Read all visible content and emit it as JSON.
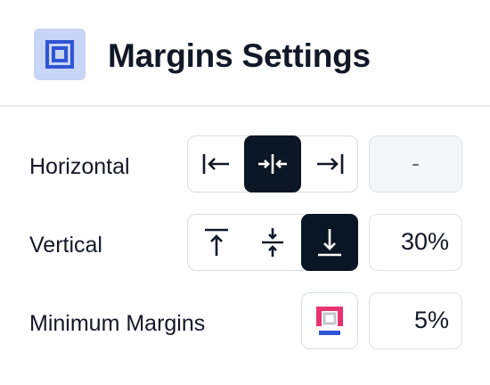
{
  "header": {
    "title": "Margins Settings",
    "icon": "margins-icon",
    "icon_bg": "#c9d5f7",
    "accent": "#2f55d4"
  },
  "horizontal": {
    "label": "Horizontal",
    "options": [
      {
        "name": "align-left",
        "icon": "arrow-to-left-bar-icon",
        "selected": false
      },
      {
        "name": "align-center",
        "icon": "arrows-inward-center-icon",
        "selected": true
      },
      {
        "name": "align-right",
        "icon": "arrow-to-right-bar-icon",
        "selected": false
      }
    ],
    "value": "-"
  },
  "vertical": {
    "label": "Vertical",
    "options": [
      {
        "name": "align-top",
        "icon": "arrow-to-top-bar-icon",
        "selected": false
      },
      {
        "name": "align-middle",
        "icon": "arrows-inward-middle-icon",
        "selected": false
      },
      {
        "name": "align-bottom",
        "icon": "arrow-to-bottom-bar-icon",
        "selected": true
      }
    ],
    "value": "30%"
  },
  "minimum": {
    "label": "Minimum Margins",
    "icon": "minimum-margins-icon",
    "icon_colors": {
      "side": "#e8336f",
      "bottom": "#2f55d4",
      "inner": "#c4c7cc"
    },
    "value": "5%"
  },
  "colors": {
    "active_segment": "#0b1624",
    "border": "#d9dde3",
    "disabled_bg": "#f5f6f8"
  }
}
